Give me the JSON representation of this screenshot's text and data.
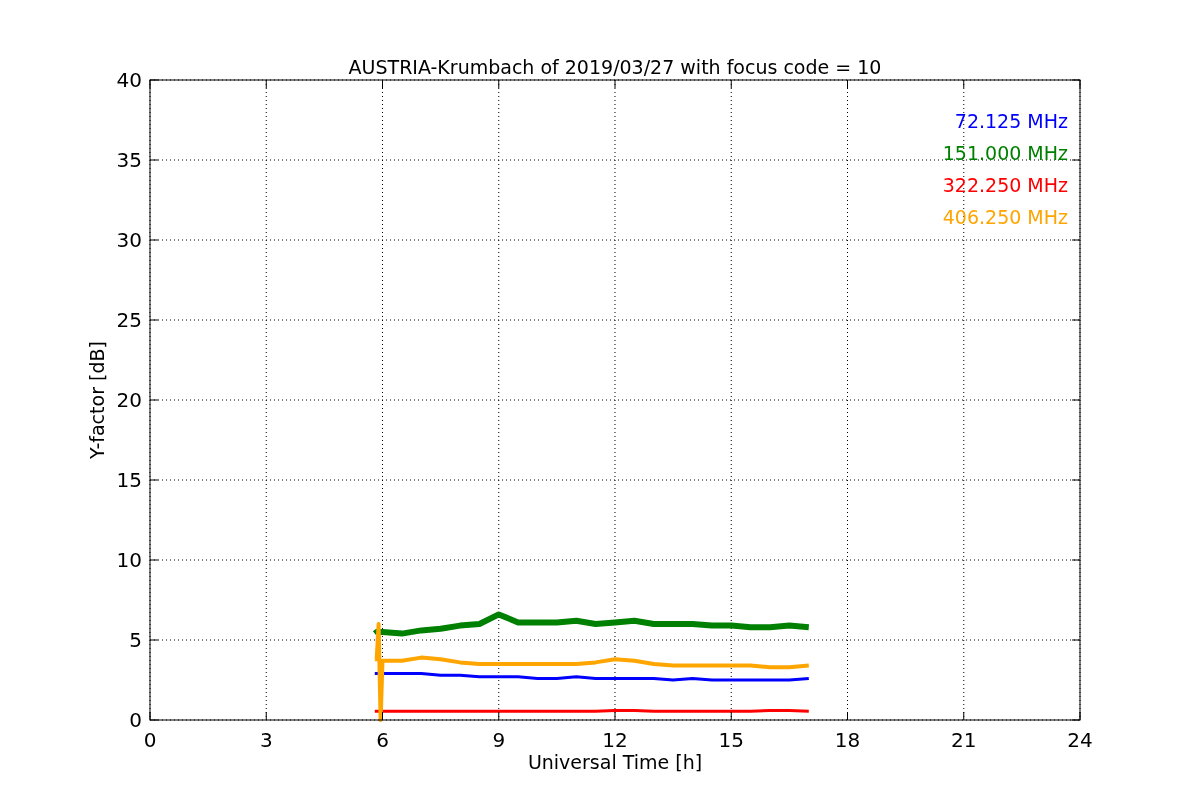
{
  "figure": {
    "chart_data": {
      "type": "line",
      "title": "AUSTRIA-Krumbach of 2019/03/27 with focus code = 10",
      "xlabel": "Universal Time [h]",
      "ylabel": "Y-factor [dB]",
      "x": [
        5.8,
        5.85,
        5.9,
        5.95,
        6.0,
        6.5,
        7.0,
        7.5,
        8.0,
        8.5,
        9.0,
        9.5,
        10.0,
        10.5,
        11.0,
        11.5,
        12.0,
        12.5,
        13.0,
        13.5,
        14.0,
        14.5,
        15.0,
        15.5,
        16.0,
        16.5,
        17.0
      ],
      "series": [
        {
          "name": "72.125 MHz",
          "color": "#0000ff",
          "values": [
            2.9,
            2.9,
            2.9,
            2.9,
            2.9,
            2.9,
            2.9,
            2.8,
            2.8,
            2.7,
            2.7,
            2.7,
            2.6,
            2.6,
            2.7,
            2.6,
            2.6,
            2.6,
            2.6,
            2.5,
            2.6,
            2.5,
            2.5,
            2.5,
            2.5,
            2.5,
            2.6
          ]
        },
        {
          "name": "151.000 MHz",
          "color": "#008000",
          "values": [
            5.4,
            5.5,
            5.5,
            5.5,
            5.5,
            5.4,
            5.6,
            5.7,
            5.9,
            6.0,
            6.6,
            6.1,
            6.1,
            6.1,
            6.2,
            6.0,
            6.1,
            6.2,
            6.0,
            6.0,
            6.0,
            5.9,
            5.9,
            5.8,
            5.8,
            5.9,
            5.8
          ]
        },
        {
          "name": "322.250 MHz",
          "color": "#ff0000",
          "values": [
            0.55,
            0.55,
            0.55,
            0.55,
            0.55,
            0.55,
            0.55,
            0.55,
            0.55,
            0.55,
            0.55,
            0.55,
            0.55,
            0.55,
            0.55,
            0.55,
            0.6,
            0.6,
            0.55,
            0.55,
            0.55,
            0.55,
            0.55,
            0.55,
            0.6,
            0.6,
            0.55
          ]
        },
        {
          "name": "406.250 MHz",
          "color": "#ffa500",
          "values": [
            3.8,
            3.8,
            6.0,
            0.0,
            3.7,
            3.7,
            3.9,
            3.8,
            3.6,
            3.5,
            3.5,
            3.5,
            3.5,
            3.5,
            3.5,
            3.6,
            3.8,
            3.7,
            3.5,
            3.4,
            3.4,
            3.4,
            3.4,
            3.4,
            3.3,
            3.3,
            3.4
          ]
        }
      ],
      "xlim": [
        0,
        24
      ],
      "ylim": [
        0,
        40
      ],
      "grid": true,
      "xticks": [
        0,
        3,
        6,
        9,
        12,
        15,
        18,
        21,
        24
      ],
      "yticks": [
        0,
        5,
        10,
        15,
        20,
        25,
        30,
        35,
        40
      ]
    }
  }
}
